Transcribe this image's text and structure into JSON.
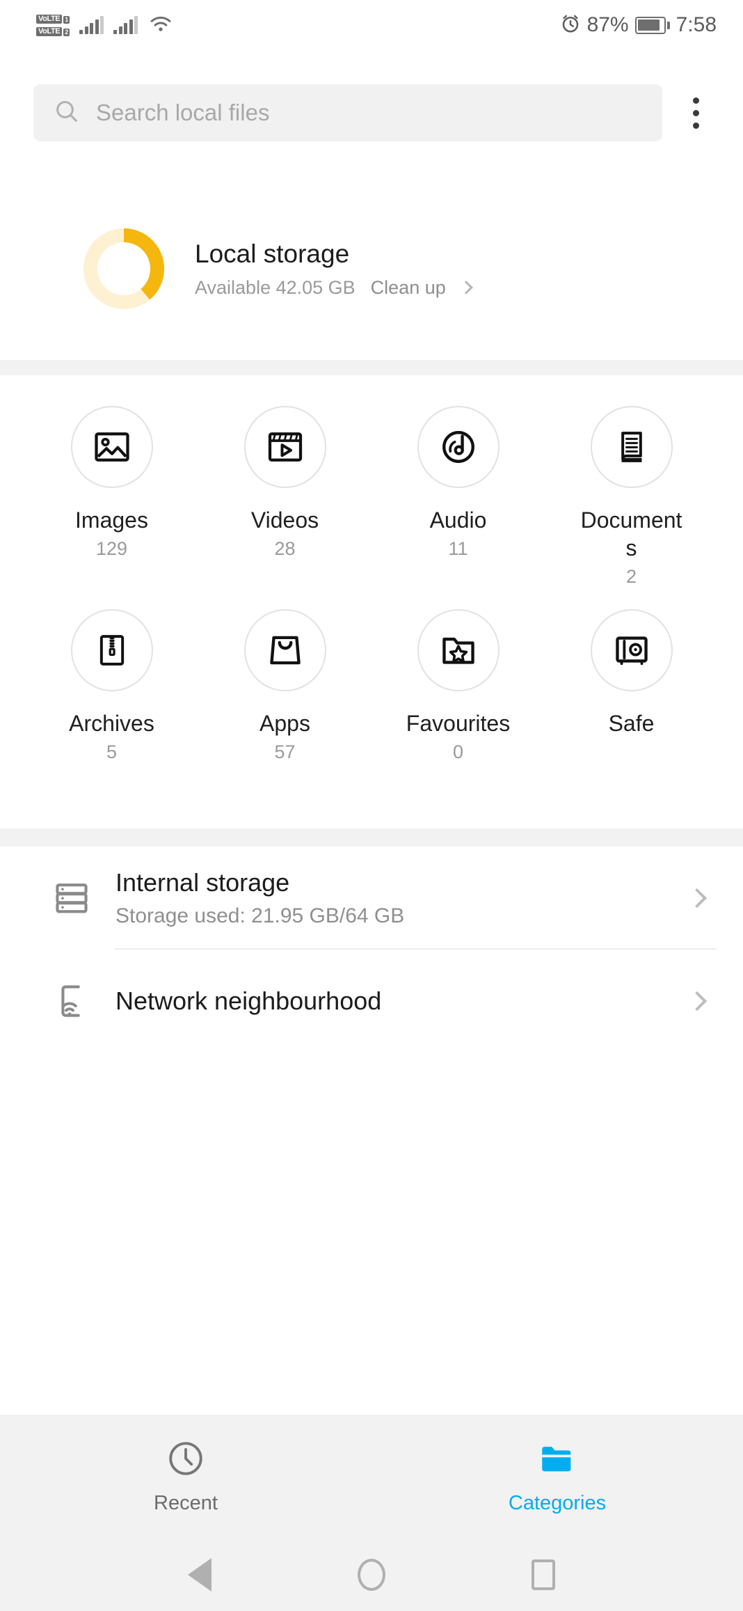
{
  "statusbar": {
    "volte": [
      {
        "label": "VoLTE",
        "sim": "1"
      },
      {
        "label": "VoLTE",
        "sim": "2"
      }
    ],
    "alarm_icon": "alarm-clock-icon",
    "battery_percent": "87%",
    "battery_level": 87,
    "time": "7:58",
    "wifi_icon": "wifi-icon",
    "signal_icon": "signal-bars-icon"
  },
  "search": {
    "placeholder": "Search local files",
    "icon": "search-icon"
  },
  "overflow_menu": {
    "icon": "more-vertical-icon"
  },
  "local_storage": {
    "title": "Local storage",
    "available": "Available 42.05 GB",
    "cleanup_label": "Clean up",
    "used_fraction_deg": 140,
    "ring_color": "#f5b60d",
    "ring_track_color": "#fdf1d2"
  },
  "categories": [
    {
      "label": "Images",
      "count": "129",
      "icon": "image-icon"
    },
    {
      "label": "Videos",
      "count": "28",
      "icon": "video-clapperboard-icon"
    },
    {
      "label": "Audio",
      "count": "11",
      "icon": "audio-disc-icon"
    },
    {
      "label": "Documents",
      "count": "2",
      "icon": "document-icon"
    },
    {
      "label": "Archives",
      "count": "5",
      "icon": "zip-archive-icon"
    },
    {
      "label": "Apps",
      "count": "57",
      "icon": "shopping-bag-icon"
    },
    {
      "label": "Favourites",
      "count": "0",
      "icon": "folder-star-icon"
    },
    {
      "label": "Safe",
      "count": "",
      "icon": "safe-vault-icon"
    }
  ],
  "storage_list": [
    {
      "title": "Internal storage",
      "subtitle": "Storage used: 21.95 GB/64 GB",
      "icon": "internal-storage-icon"
    },
    {
      "title": "Network neighbourhood",
      "subtitle": "",
      "icon": "network-phone-wifi-icon"
    }
  ],
  "tabs": [
    {
      "label": "Recent",
      "icon": "clock-icon",
      "active": false
    },
    {
      "label": "Categories",
      "icon": "folder-icon",
      "active": true
    }
  ],
  "accent_color": "#00aeef",
  "navbar": {
    "back": "back-triangle-icon",
    "home": "home-circle-icon",
    "recents": "recents-square-icon"
  }
}
